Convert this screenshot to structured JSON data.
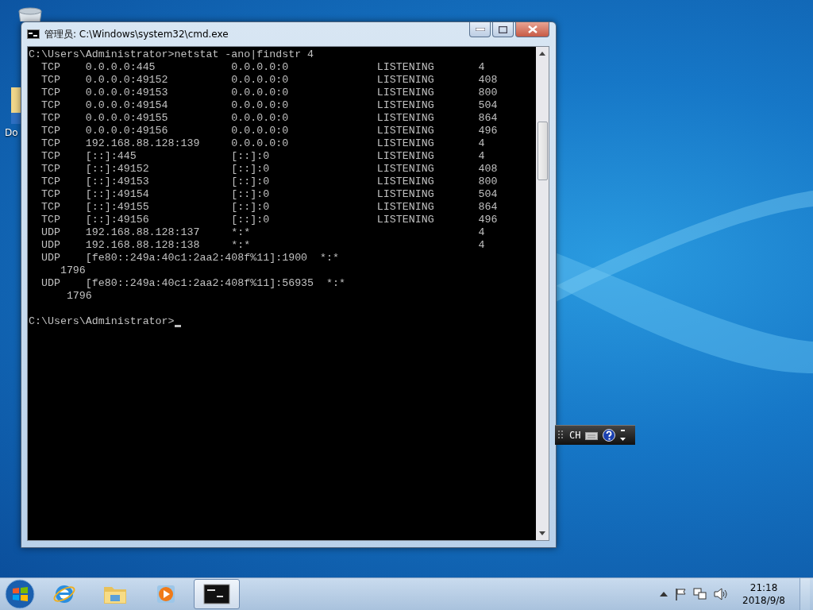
{
  "desktop_icons": [
    {
      "label": "Do"
    }
  ],
  "window": {
    "title": "管理员: C:\\Windows\\system32\\cmd.exe",
    "console_lines": [
      "C:\\Users\\Administrator>netstat -ano|findstr 4",
      "  TCP    0.0.0.0:445            0.0.0.0:0              LISTENING       4",
      "  TCP    0.0.0.0:49152          0.0.0.0:0              LISTENING       408",
      "  TCP    0.0.0.0:49153          0.0.0.0:0              LISTENING       800",
      "  TCP    0.0.0.0:49154          0.0.0.0:0              LISTENING       504",
      "  TCP    0.0.0.0:49155          0.0.0.0:0              LISTENING       864",
      "  TCP    0.0.0.0:49156          0.0.0.0:0              LISTENING       496",
      "  TCP    192.168.88.128:139     0.0.0.0:0              LISTENING       4",
      "  TCP    [::]:445               [::]:0                 LISTENING       4",
      "  TCP    [::]:49152             [::]:0                 LISTENING       408",
      "  TCP    [::]:49153             [::]:0                 LISTENING       800",
      "  TCP    [::]:49154             [::]:0                 LISTENING       504",
      "  TCP    [::]:49155             [::]:0                 LISTENING       864",
      "  TCP    [::]:49156             [::]:0                 LISTENING       496",
      "  UDP    192.168.88.128:137     *:*                                    4",
      "  UDP    192.168.88.128:138     *:*                                    4",
      "  UDP    [fe80::249a:40c1:2aa2:408f%11]:1900  *:*",
      "     1796",
      "  UDP    [fe80::249a:40c1:2aa2:408f%11]:56935  *:*",
      "      1796",
      "C:\\Users\\Administrator>"
    ]
  },
  "language_bar": {
    "label": "CH"
  },
  "taskbar": {
    "apps": [
      {
        "kind": "browser",
        "selected": false
      },
      {
        "kind": "folder",
        "selected": false
      },
      {
        "kind": "media",
        "selected": false
      },
      {
        "kind": "console",
        "selected": true
      }
    ],
    "clock": {
      "time": "21:18",
      "date": "2018/9/8"
    }
  }
}
